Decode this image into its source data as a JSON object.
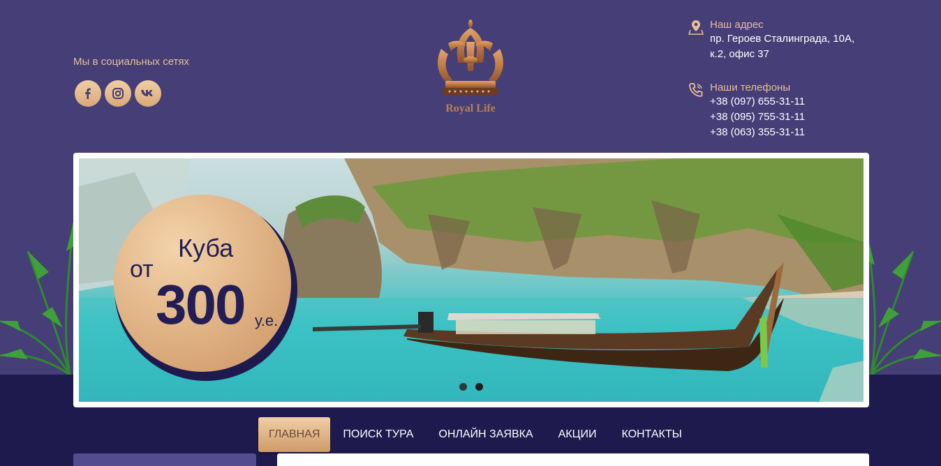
{
  "header": {
    "social": {
      "title": "Мы в социальных сетях",
      "links": [
        {
          "icon": "facebook-icon",
          "glyph": "f"
        },
        {
          "icon": "instagram-icon",
          "glyph": ""
        },
        {
          "icon": "vk-icon",
          "glyph": "vk"
        }
      ]
    },
    "logo": {
      "text": "Royal Life"
    },
    "address": {
      "title": "Наш адрес",
      "lines": [
        "пр. Героев Сталинграда, 10А,",
        "к.2, офис 37"
      ]
    },
    "phones": {
      "title": "Наши телефоны",
      "lines": [
        "+38 (097) 655-31-11",
        "+38 (095) 755-31-11",
        "+38 (063) 355-31-11"
      ]
    }
  },
  "slider": {
    "promo": {
      "country": "Куба",
      "from": "от",
      "price": "300",
      "unit": "у.е."
    },
    "dots_count": 2,
    "active_dot": 2
  },
  "nav": {
    "items": [
      "ГЛАВНАЯ",
      "ПОИСК ТУРА",
      "ОНЛАЙН ЗАЯВКА",
      "АКЦИИ",
      "КОНТАКТЫ"
    ],
    "active_index": 0
  },
  "colors": {
    "header_bg": "#453e77",
    "footer_bg": "#1e1a4d",
    "accent_gold": "#e8bf94",
    "promo_text": "#221d55"
  }
}
